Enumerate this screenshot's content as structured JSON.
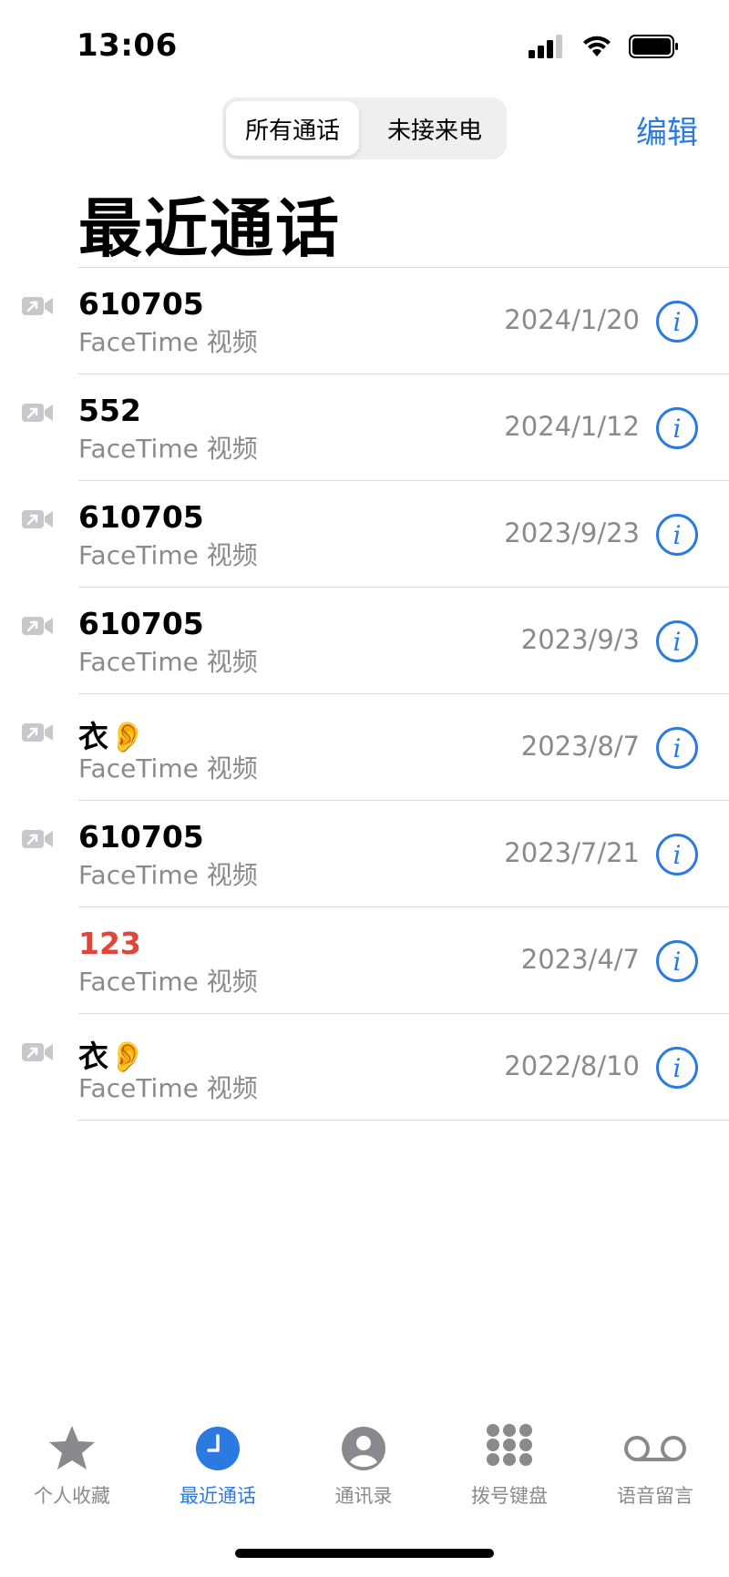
{
  "status_bar": {
    "time": "13:06"
  },
  "segmented": {
    "all_calls": "所有通话",
    "missed_calls": "未接来电"
  },
  "header": {
    "edit": "编辑",
    "title": "最近通话"
  },
  "calls": [
    {
      "name": "610705",
      "type": "FaceTime 视频",
      "date": "2024/1/20",
      "missed": false,
      "video_icon": true
    },
    {
      "name": "552",
      "type": "FaceTime 视频",
      "date": "2024/1/12",
      "missed": false,
      "video_icon": true
    },
    {
      "name": "610705",
      "type": "FaceTime 视频",
      "date": "2023/9/23",
      "missed": false,
      "video_icon": true
    },
    {
      "name": "610705",
      "type": "FaceTime 视频",
      "date": "2023/9/3",
      "missed": false,
      "video_icon": true
    },
    {
      "name": "衣👂",
      "type": "FaceTime 视频",
      "date": "2023/8/7",
      "missed": false,
      "video_icon": true
    },
    {
      "name": "610705",
      "type": "FaceTime 视频",
      "date": "2023/7/21",
      "missed": false,
      "video_icon": true
    },
    {
      "name": "123",
      "type": "FaceTime 视频",
      "date": "2023/4/7",
      "missed": true,
      "video_icon": false
    },
    {
      "name": "衣👂",
      "type": "FaceTime 视频",
      "date": "2022/8/10",
      "missed": false,
      "video_icon": true
    }
  ],
  "tabs": [
    {
      "label": "个人收藏",
      "icon": "star-icon",
      "active": false
    },
    {
      "label": "最近通话",
      "icon": "clock-icon",
      "active": true
    },
    {
      "label": "通讯录",
      "icon": "person-icon",
      "active": false
    },
    {
      "label": "拨号键盘",
      "icon": "keypad-icon",
      "active": false
    },
    {
      "label": "语音留言",
      "icon": "voicemail-icon",
      "active": false
    }
  ],
  "colors": {
    "accent": "#2a7ae2",
    "missed": "#e0443a",
    "secondary_text": "#8a8a8e"
  }
}
